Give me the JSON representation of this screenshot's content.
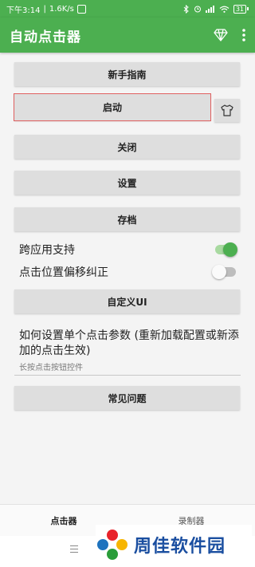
{
  "statusbar": {
    "time": "下午3:14",
    "separator": "|",
    "speed": "1.6K/s",
    "battery": "31"
  },
  "appbar": {
    "title": "自动点击器",
    "diamond_icon": "diamond-icon",
    "more_icon": "more-vertical-icon"
  },
  "buttons": {
    "guide": "新手指南",
    "start": "启动",
    "close": "关闭",
    "settings": "设置",
    "archive": "存档",
    "custom_ui": "自定义UI",
    "faq": "常见问题"
  },
  "toggles": {
    "cross_app": {
      "label": "跨应用支持",
      "on": true
    },
    "offset_fix": {
      "label": "点击位置偏移纠正",
      "on": false
    }
  },
  "help": {
    "question": "如何设置单个点击参数 (重新加载配置或新添加的点击生效)",
    "hint": "长按点击按钮控件"
  },
  "bottom_nav": {
    "tabs": [
      "点击器",
      "录制器"
    ],
    "active": 0
  },
  "watermark": "周佳软件园",
  "colors": {
    "primary": "#4caf50",
    "switch_on": "#7cc576",
    "switch_off": "#bdbdbd"
  }
}
